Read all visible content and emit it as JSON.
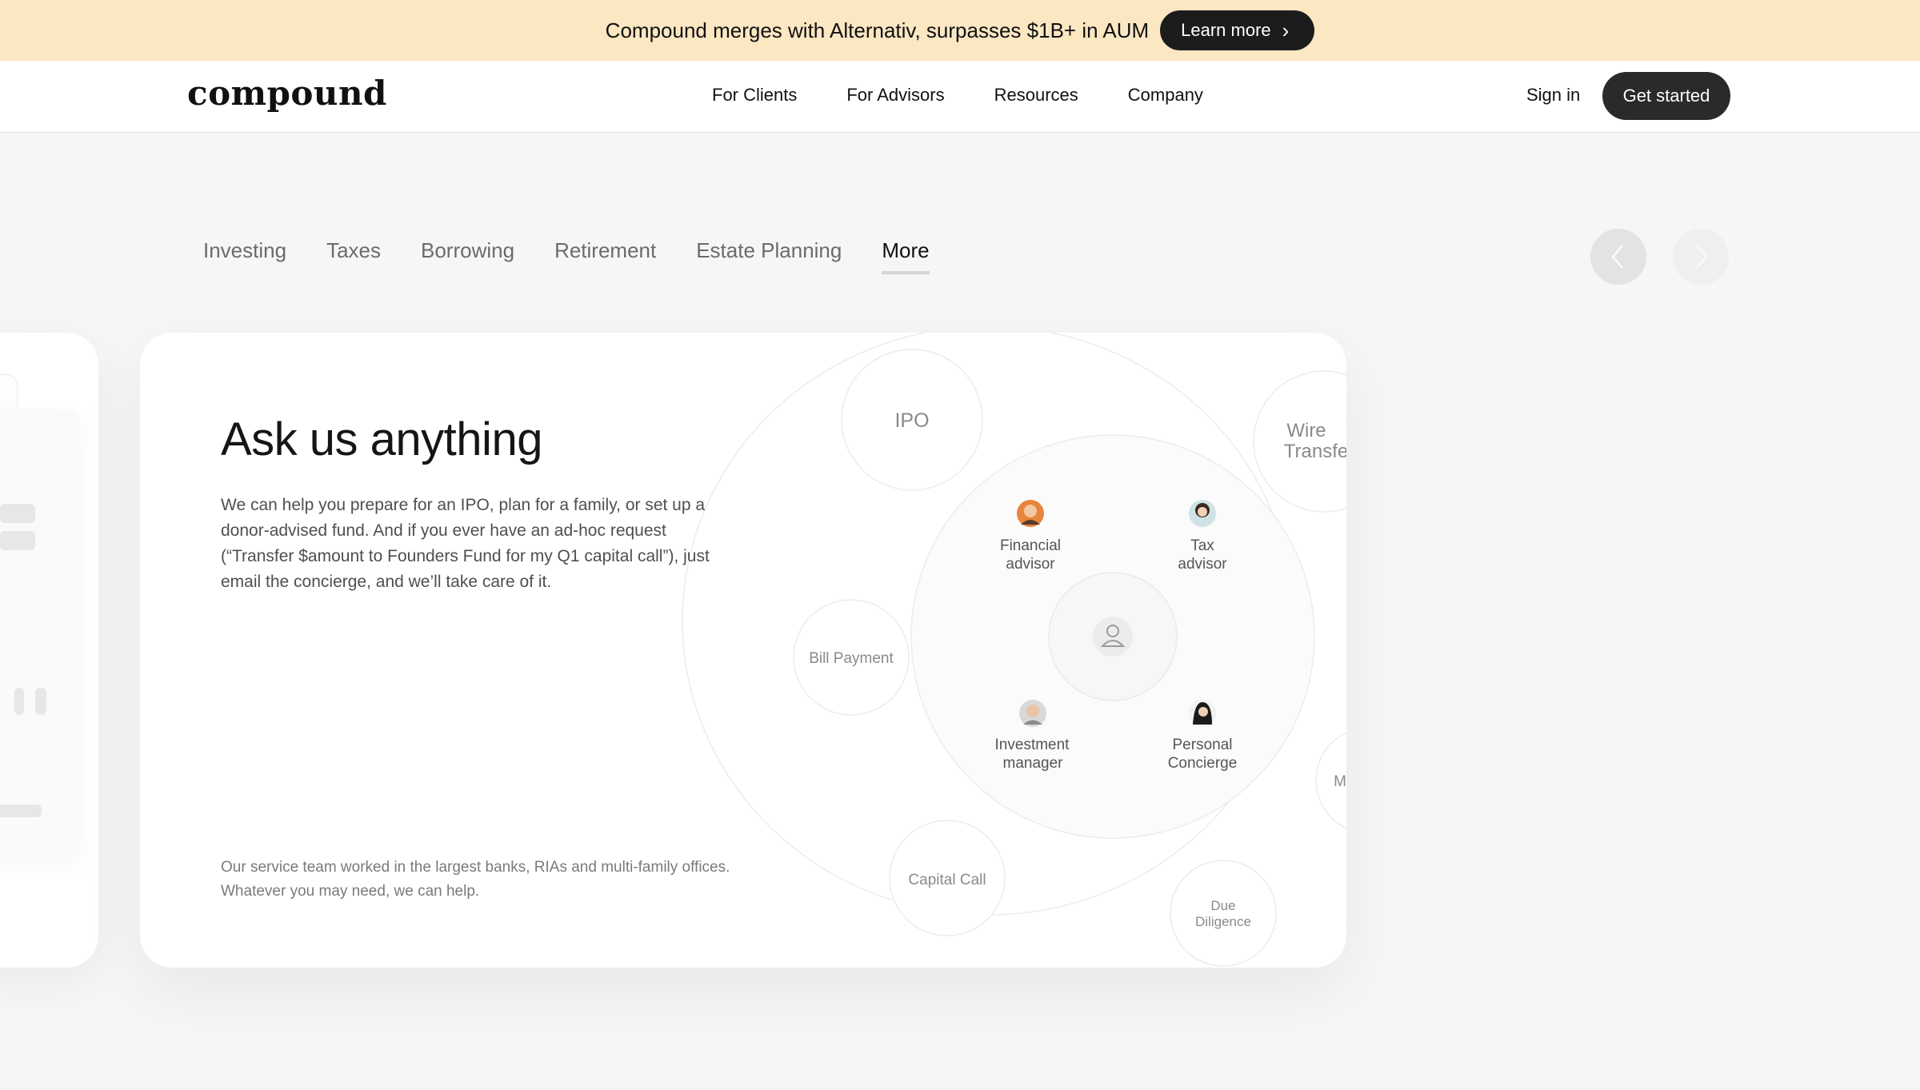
{
  "banner": {
    "text": "Compound merges with Alternativ, surpasses $1B+ in AUM",
    "button_label": "Learn more"
  },
  "nav": {
    "logo": "compound",
    "links": [
      "For Clients",
      "For Advisors",
      "Resources",
      "Company"
    ],
    "sign_in": "Sign in",
    "cta": "Get started"
  },
  "tabs": {
    "items": [
      "Investing",
      "Taxes",
      "Borrowing",
      "Retirement",
      "Estate Planning",
      "More"
    ],
    "active": "More"
  },
  "card": {
    "heading": "Ask us anything",
    "description": "We can help you prepare for an IPO, plan for a family, or set up a donor-advised fund. And if you ever have an ad-hoc request (“Transfer $amount to Founders Fund for my Q1 capital call”), just email the concierge, and we’ll take care of it.",
    "footnote": "Our service team worked in the largest banks, RIAs and multi-family offices. Whatever you may need, we can help."
  },
  "diagram": {
    "outer_nodes": {
      "ipo": "IPO",
      "wire_1": "Wire",
      "wire_2": "Transfe",
      "bill": "Bill Payment",
      "capital": "Capital Call",
      "due_1": "Due",
      "due_2": "Diligence",
      "m": "M"
    },
    "advisors": {
      "financial_1": "Financial",
      "financial_2": "advisor",
      "tax_1": "Tax",
      "tax_2": "advisor",
      "investment_1": "Investment",
      "investment_2": "manager",
      "concierge_1": "Personal",
      "concierge_2": "Concierge"
    }
  },
  "icons": {
    "banner_chevron": "chevron-right-icon",
    "prev": "chevron-left-icon",
    "next": "chevron-right-icon",
    "center": "user-icon"
  }
}
